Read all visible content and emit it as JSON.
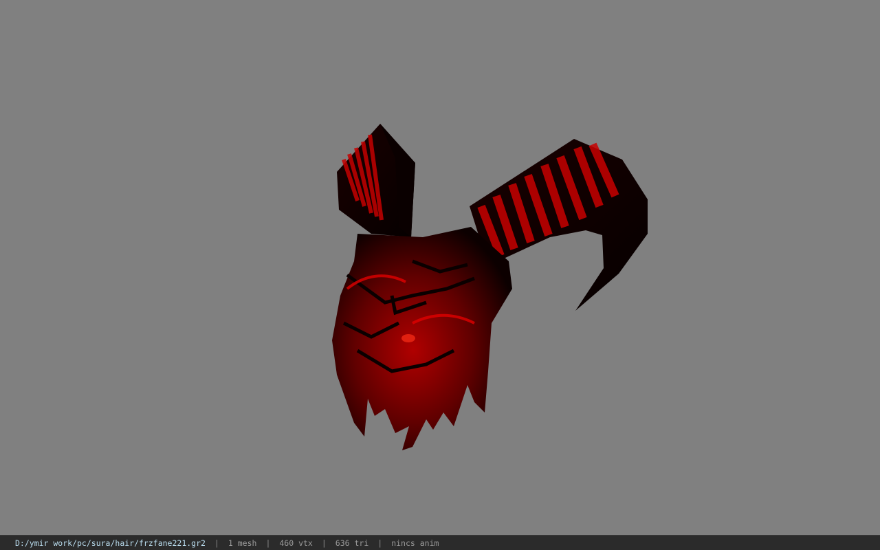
{
  "status_bar": {
    "file_path": "D:/ymir work/pc/sura/hair/frzfane221.gr2",
    "separator": "|",
    "mesh_count": "1 mesh",
    "vertex_count": "460 vtx",
    "triangle_count": "636 tri",
    "animation_status": "nincs anim"
  },
  "viewport": {
    "background_color": "#808080",
    "model": {
      "icon": "demon-helmet-model",
      "base_color": "#0a0000",
      "accent_color": "#c00000"
    }
  }
}
